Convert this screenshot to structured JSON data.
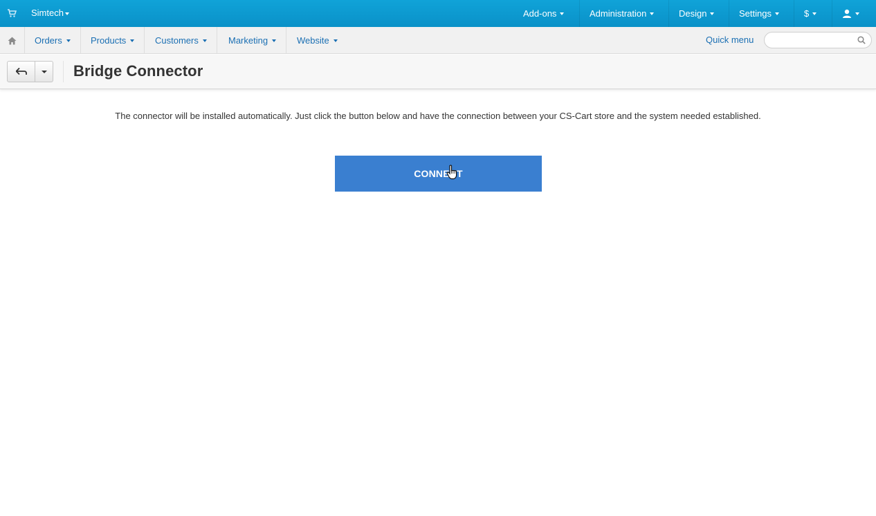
{
  "topbar": {
    "brand": "Simtech",
    "menus": [
      "Add-ons",
      "Administration",
      "Design",
      "Settings",
      "$"
    ],
    "icons": {
      "cart": "cart-icon",
      "user": "user-icon"
    }
  },
  "navbar": {
    "items": [
      "Orders",
      "Products",
      "Customers",
      "Marketing",
      "Website"
    ],
    "quick_menu": "Quick menu",
    "search_placeholder": "",
    "icons": {
      "home": "home-icon",
      "search": "search-icon"
    }
  },
  "titlebar": {
    "title": "Bridge Connector",
    "icons": {
      "back": "back-arrow-icon",
      "dropdown": "caret-down-icon"
    }
  },
  "content": {
    "intro_text": "The connector will be installed automatically. Just click the button below and have the connection between your CS-Cart store and the system needed established.",
    "connect_label": "CONNECT"
  },
  "colors": {
    "topbar": "#0d9bd1",
    "link": "#1a6fb3",
    "button": "#3a7fd0",
    "navbar_bg": "#f1f1f1"
  }
}
